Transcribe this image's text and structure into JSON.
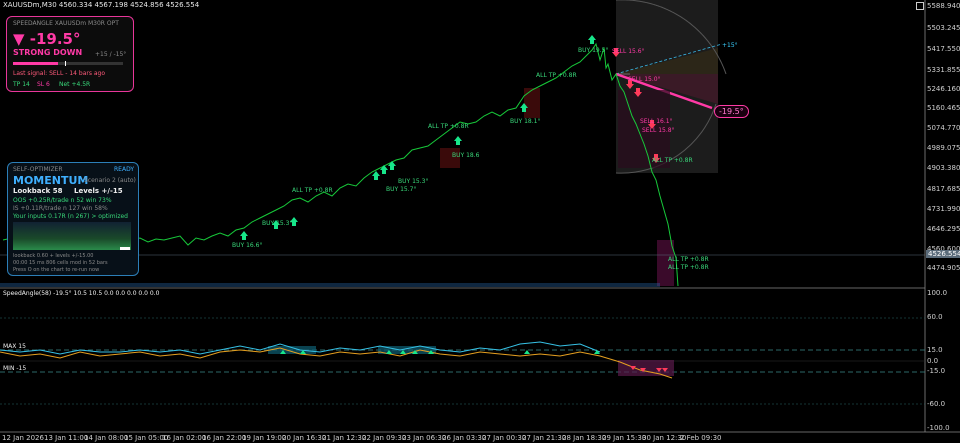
{
  "header": {
    "symbol_line": "XAUUSDm,M30  4560.334 4567.198 4524.856 4526.554"
  },
  "price_axis": {
    "labels": [
      "5588.940",
      "5503.245",
      "5417.550",
      "5331.855",
      "5246.160",
      "5160.465",
      "5074.770",
      "4989.075",
      "4903.380",
      "4817.685",
      "4731.990",
      "4646.295",
      "4560.600",
      "4474.905"
    ],
    "current_price": "4526.554"
  },
  "time_axis": [
    "12 Jan 2026",
    "13 Jan 11:00",
    "14 Jan 08:00",
    "15 Jan 05:00",
    "16 Jan 02:00",
    "16 Jan 22:00",
    "19 Jan 19:00",
    "20 Jan 16:30",
    "21 Jan 12:30",
    "22 Jan 09:30",
    "23 Jan 06:30",
    "26 Jan 03:30",
    "27 Jan 00:30",
    "27 Jan 21:30",
    "28 Jan 18:30",
    "29 Jan 15:30",
    "30 Jan 12:30",
    "2 Feb 09:30"
  ],
  "speed_panel": {
    "title": "SPEEDANGLE  XAUUSDm  M30R  OPT",
    "angle": "▼ -19.5°",
    "state": "STRONG DOWN",
    "levels": "+15 / -15°",
    "last_signal": "Last signal: SELL  -  14 bars ago",
    "stats_tp": "TP 14",
    "stats_sl": "SL 6",
    "stats_net": "Net +4.5R"
  },
  "optimizer_panel": {
    "title": "SELF-OPTIMIZER",
    "status": "READY",
    "mode": "MOMENTUM",
    "mode_sub": "Scenario 2 (auto)",
    "lookback": "Lookback 58",
    "levels": "Levels +/-15",
    "oos": "OOS  +0.25R/trade  n 52  win 73%",
    "is": "IS  +0.11R/trade  n 127  win 58%",
    "inputs": "Your inputs  0.17R (n 267)  >  optimized",
    "footer1": "lookback 0.60 + levels +/-15.00",
    "footer2": "00:00  15 ms  806 cells  mod in 52 bars",
    "footer3": "Press O on the chart to re-run now"
  },
  "chart_labels": {
    "all_tp_1": "ALL TP +0.8R",
    "all_tp_2": "ALL TP +0.8R",
    "all_tp_3": "ALL TP +0.8R",
    "all_tp_4": "ALL TP +0.8R",
    "all_tp_5": "ALL TP +0.8R",
    "all_tp_6": "ALL TP +0.8R",
    "buy_1": "BUY 16.6°",
    "buy_2": "BUY 15.3°",
    "buy_3": "BUY 15.7°",
    "buy_4": "BUY 15.3°",
    "buy_5": "BUY 18.6",
    "buy_6": "BUY 18.1°",
    "buy_7": "BUY 19.5°",
    "sell_1": "SELL 15.6°",
    "sell_2": "SELL 15.0°",
    "sell_3": "SELL 16.1°",
    "sell_4": "SELL 15.8°",
    "angle_tag": "-19.5°",
    "level_tag": "+15°"
  },
  "indicator": {
    "title": "SpeedAngle(58)  -19.5°  10.5  10.5 0.0  0.0  0.0 0.0  0.0",
    "max_label": "MAX 15",
    "min_label": "MIN -15",
    "axis": [
      "100.0",
      "60.0",
      "15.0",
      "0.0",
      "-15.0",
      "-60.0",
      "-100.0"
    ]
  },
  "colors": {
    "up": "#17c93a",
    "down": "#ff3aa6",
    "accent_blue": "#2c7fb8",
    "osc_up": "#37c2e6",
    "osc_down": "#e6a020"
  }
}
